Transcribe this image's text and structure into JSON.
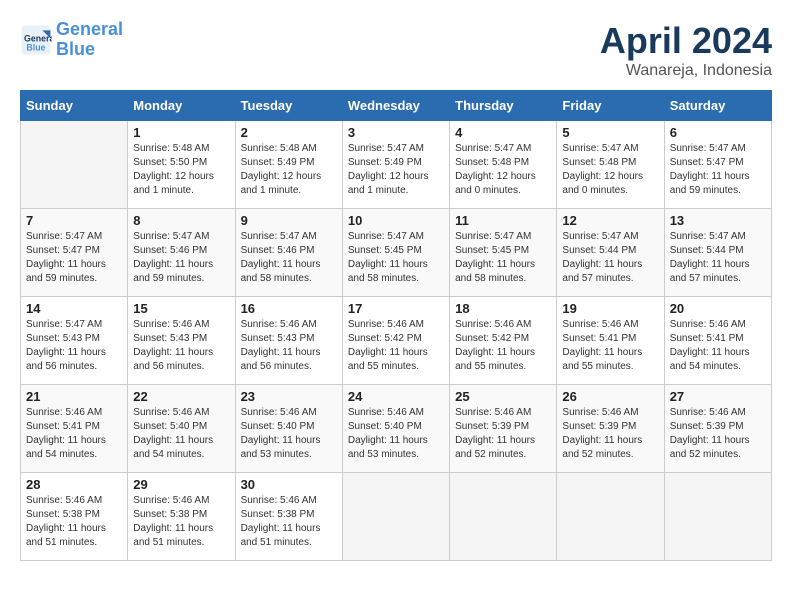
{
  "header": {
    "logo_line1": "General",
    "logo_line2": "Blue",
    "month_title": "April 2024",
    "subtitle": "Wanareja, Indonesia"
  },
  "days_of_week": [
    "Sunday",
    "Monday",
    "Tuesday",
    "Wednesday",
    "Thursday",
    "Friday",
    "Saturday"
  ],
  "weeks": [
    [
      {
        "day": "",
        "info": ""
      },
      {
        "day": "1",
        "info": "Sunrise: 5:48 AM\nSunset: 5:50 PM\nDaylight: 12 hours\nand 1 minute."
      },
      {
        "day": "2",
        "info": "Sunrise: 5:48 AM\nSunset: 5:49 PM\nDaylight: 12 hours\nand 1 minute."
      },
      {
        "day": "3",
        "info": "Sunrise: 5:47 AM\nSunset: 5:49 PM\nDaylight: 12 hours\nand 1 minute."
      },
      {
        "day": "4",
        "info": "Sunrise: 5:47 AM\nSunset: 5:48 PM\nDaylight: 12 hours\nand 0 minutes."
      },
      {
        "day": "5",
        "info": "Sunrise: 5:47 AM\nSunset: 5:48 PM\nDaylight: 12 hours\nand 0 minutes."
      },
      {
        "day": "6",
        "info": "Sunrise: 5:47 AM\nSunset: 5:47 PM\nDaylight: 11 hours\nand 59 minutes."
      }
    ],
    [
      {
        "day": "7",
        "info": "Sunrise: 5:47 AM\nSunset: 5:47 PM\nDaylight: 11 hours\nand 59 minutes."
      },
      {
        "day": "8",
        "info": "Sunrise: 5:47 AM\nSunset: 5:46 PM\nDaylight: 11 hours\nand 59 minutes."
      },
      {
        "day": "9",
        "info": "Sunrise: 5:47 AM\nSunset: 5:46 PM\nDaylight: 11 hours\nand 58 minutes."
      },
      {
        "day": "10",
        "info": "Sunrise: 5:47 AM\nSunset: 5:45 PM\nDaylight: 11 hours\nand 58 minutes."
      },
      {
        "day": "11",
        "info": "Sunrise: 5:47 AM\nSunset: 5:45 PM\nDaylight: 11 hours\nand 58 minutes."
      },
      {
        "day": "12",
        "info": "Sunrise: 5:47 AM\nSunset: 5:44 PM\nDaylight: 11 hours\nand 57 minutes."
      },
      {
        "day": "13",
        "info": "Sunrise: 5:47 AM\nSunset: 5:44 PM\nDaylight: 11 hours\nand 57 minutes."
      }
    ],
    [
      {
        "day": "14",
        "info": "Sunrise: 5:47 AM\nSunset: 5:43 PM\nDaylight: 11 hours\nand 56 minutes."
      },
      {
        "day": "15",
        "info": "Sunrise: 5:46 AM\nSunset: 5:43 PM\nDaylight: 11 hours\nand 56 minutes."
      },
      {
        "day": "16",
        "info": "Sunrise: 5:46 AM\nSunset: 5:43 PM\nDaylight: 11 hours\nand 56 minutes."
      },
      {
        "day": "17",
        "info": "Sunrise: 5:46 AM\nSunset: 5:42 PM\nDaylight: 11 hours\nand 55 minutes."
      },
      {
        "day": "18",
        "info": "Sunrise: 5:46 AM\nSunset: 5:42 PM\nDaylight: 11 hours\nand 55 minutes."
      },
      {
        "day": "19",
        "info": "Sunrise: 5:46 AM\nSunset: 5:41 PM\nDaylight: 11 hours\nand 55 minutes."
      },
      {
        "day": "20",
        "info": "Sunrise: 5:46 AM\nSunset: 5:41 PM\nDaylight: 11 hours\nand 54 minutes."
      }
    ],
    [
      {
        "day": "21",
        "info": "Sunrise: 5:46 AM\nSunset: 5:41 PM\nDaylight: 11 hours\nand 54 minutes."
      },
      {
        "day": "22",
        "info": "Sunrise: 5:46 AM\nSunset: 5:40 PM\nDaylight: 11 hours\nand 54 minutes."
      },
      {
        "day": "23",
        "info": "Sunrise: 5:46 AM\nSunset: 5:40 PM\nDaylight: 11 hours\nand 53 minutes."
      },
      {
        "day": "24",
        "info": "Sunrise: 5:46 AM\nSunset: 5:40 PM\nDaylight: 11 hours\nand 53 minutes."
      },
      {
        "day": "25",
        "info": "Sunrise: 5:46 AM\nSunset: 5:39 PM\nDaylight: 11 hours\nand 52 minutes."
      },
      {
        "day": "26",
        "info": "Sunrise: 5:46 AM\nSunset: 5:39 PM\nDaylight: 11 hours\nand 52 minutes."
      },
      {
        "day": "27",
        "info": "Sunrise: 5:46 AM\nSunset: 5:39 PM\nDaylight: 11 hours\nand 52 minutes."
      }
    ],
    [
      {
        "day": "28",
        "info": "Sunrise: 5:46 AM\nSunset: 5:38 PM\nDaylight: 11 hours\nand 51 minutes."
      },
      {
        "day": "29",
        "info": "Sunrise: 5:46 AM\nSunset: 5:38 PM\nDaylight: 11 hours\nand 51 minutes."
      },
      {
        "day": "30",
        "info": "Sunrise: 5:46 AM\nSunset: 5:38 PM\nDaylight: 11 hours\nand 51 minutes."
      },
      {
        "day": "",
        "info": ""
      },
      {
        "day": "",
        "info": ""
      },
      {
        "day": "",
        "info": ""
      },
      {
        "day": "",
        "info": ""
      }
    ]
  ]
}
